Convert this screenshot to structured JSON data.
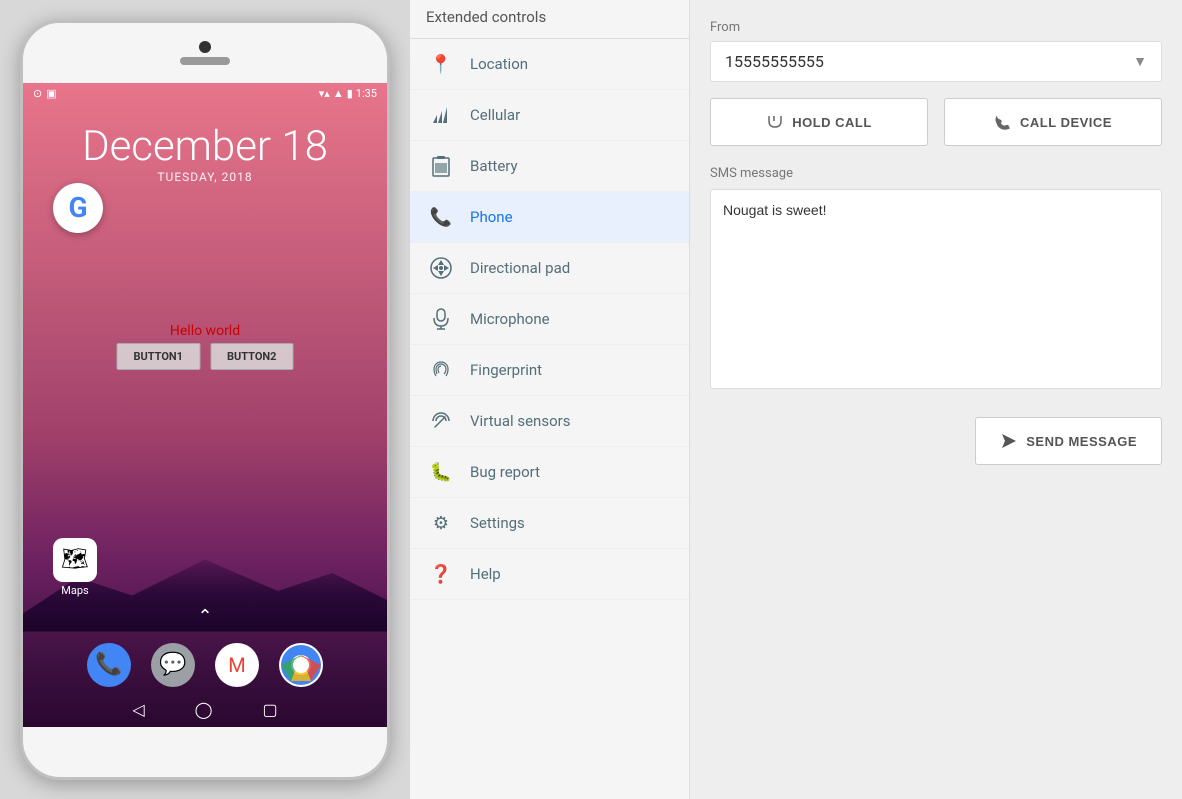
{
  "header": {
    "title": "Extended controls"
  },
  "sidebar": {
    "items": [
      {
        "id": "location",
        "label": "Location",
        "icon": "📍"
      },
      {
        "id": "cellular",
        "label": "Cellular",
        "icon": "📶"
      },
      {
        "id": "battery",
        "label": "Battery",
        "icon": "🔋"
      },
      {
        "id": "phone",
        "label": "Phone",
        "icon": "📞",
        "active": true
      },
      {
        "id": "directional-pad",
        "label": "Directional pad",
        "icon": "🎯"
      },
      {
        "id": "microphone",
        "label": "Microphone",
        "icon": "🎤"
      },
      {
        "id": "fingerprint",
        "label": "Fingerprint",
        "icon": "👆"
      },
      {
        "id": "virtual-sensors",
        "label": "Virtual sensors",
        "icon": "↺"
      },
      {
        "id": "bug-report",
        "label": "Bug report",
        "icon": "🐛"
      },
      {
        "id": "settings",
        "label": "Settings",
        "icon": "⚙"
      },
      {
        "id": "help",
        "label": "Help",
        "icon": "❓"
      }
    ]
  },
  "phone": {
    "date_main": "December 18",
    "date_sub": "TUESDAY, 2018",
    "time": "1:35",
    "hello_text": "Hello world",
    "button1": "BUTTON1",
    "button2": "BUTTON2",
    "maps_label": "Maps",
    "chevron": "⌃"
  },
  "main": {
    "from_label": "From",
    "from_number": "15555555555",
    "hold_call_label": "HOLD CALL",
    "call_device_label": "CALL DEVICE",
    "sms_label": "SMS message",
    "sms_text": "Nougat is sweet!",
    "send_label": "SEND MESSAGE"
  }
}
